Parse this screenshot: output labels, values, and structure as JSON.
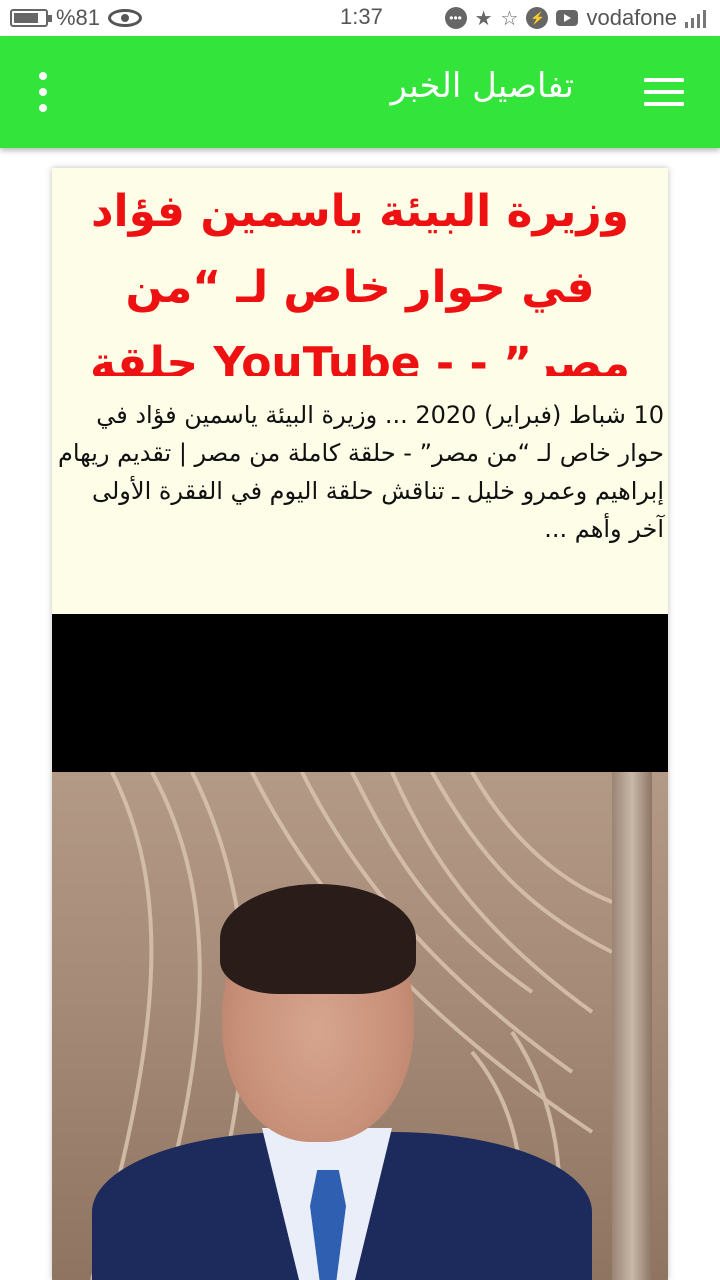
{
  "status_bar": {
    "battery": "%81",
    "time": "1:37",
    "carrier": "vodafone",
    "battery_level": 0.81,
    "icons": [
      "battery-icon",
      "eye-icon",
      "chat-bubble-icon",
      "star-filled-icon",
      "star-outline-icon",
      "messenger-icon",
      "youtube-icon",
      "wifi-icon",
      "signal-icon"
    ]
  },
  "app_bar": {
    "title": "تفاصيل الخبر",
    "background": "#33e43a",
    "icons": [
      "menu-icon",
      "overflow-menu-icon"
    ]
  },
  "article": {
    "headline": "وزيرة البيئة ياسمين فؤاد في حوار خاص لـ “من مصر” - - YouTube حلقة كاملة",
    "snippet_line1": "10 شباط (فبراير) 2020 ... وزيرة البيئة ياسمين فؤاد في حوار خاص لـ “من مصر” - حلقة كاملة من مصر | تقديم ريهام",
    "snippet_line2": "إبراهيم وعمرو خليل ـ تناقش حلقة اليوم في الفقرة الأولى آخر وأهم ...",
    "headline_color": "#ee1111",
    "card_background": "#fefde8"
  }
}
